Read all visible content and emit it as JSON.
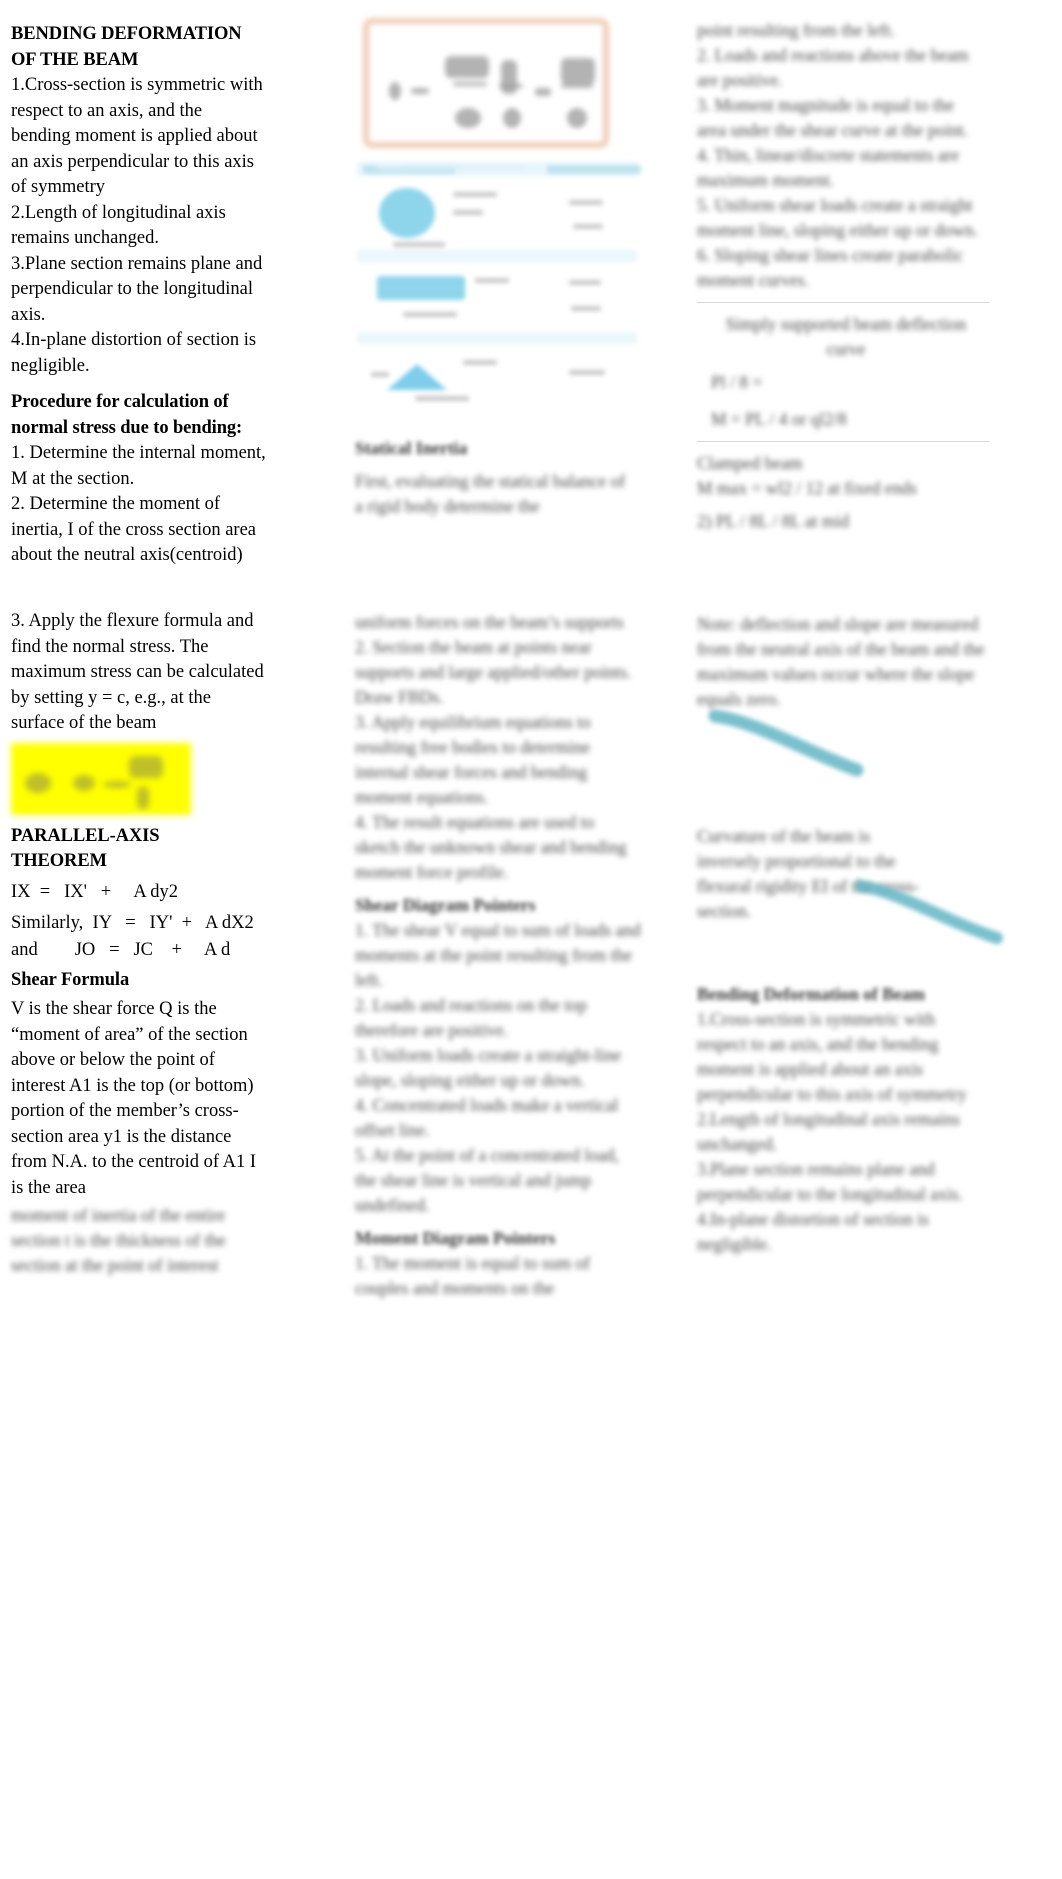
{
  "document": {
    "title": "BENDING DEFORMATION OF THE BEAM",
    "layout": "three-column study notes",
    "highlight_color": "#ffff00",
    "accent_border_color": "#f0cdb6",
    "accent_table_color": "#8ed5ec",
    "accent_curve_color": "#62b5c4"
  },
  "column1": {
    "heading1_line1": "BENDING DEFORMATION",
    "heading1_line2": "OF THE BEAM",
    "item1": "1.Cross-section is symmetric with respect to an axis, and the bending moment is applied about an axis perpendicular to this axis of symmetry",
    "item2": "2.Length of longitudinal axis remains unchanged.",
    "item3": "3.Plane section remains plane and perpendicular to the longitudinal axis.",
    "item4": " 4.In-plane distortion of section is negligible.",
    "heading2_line1": "Procedure for calculation of",
    "heading2_line2": "normal stress due to bending:",
    "step1": "1. Determine the internal moment, M at the section.",
    "step2": "2. Determine the moment of inertia, I of the cross section area about the neutral axis(centroid)"
  },
  "column1_lower": {
    "step3": "3. Apply the flexure formula and find the normal stress.   The maximum stress can be calculated by setting y = c, e.g., at the surface of the beam",
    "highlighted_formula": "(blurred highlighted flexure formula)",
    "heading_parallel_axis_line1": "PARALLEL-AXIS",
    "heading_parallel_axis_line2": "THEOREM",
    "formula_ix": "IX  =   IX'   +     A dy2",
    "formula_iy": "Similarly,  IY   =   IY'  +   A dX2",
    "formula_jo": "and        JO   =   JC    +     A d",
    "heading_shear_formula": "Shear Formula",
    "shear_body": "V is the shear force Q is the “moment of area” of the section above or below      the point of interest A1 is the top (or bottom) portion of the member’s cross-section area y1 is the distance from N.A. to the centroid of A1 I is the area",
    "shear_body_blurred_line1": "moment of inertia of the entire",
    "shear_body_blurred_line2": "section t is the thickness of the",
    "shear_body_blurred_line3": "section at the point of interest"
  },
  "column2": {
    "formula_card_caption": "(blurred boxed formula with peach border)",
    "table_caption": "(blurred reference table of cross-section shapes and properties)",
    "heading_statical": "Statical Inertia",
    "blurred_paragraph_1": "First, evaluating the statical balance of a rigid body determine the",
    "block2_lines": [
      "uniform forces on the beam’s supports",
      "2. Section the beam at points near supports and large applied/other points.  Draw FBDs.",
      "3. Apply equilibrium equations to resulting free bodies to determine internal shear forces and bending moment equations.",
      "4. The result equations are used to sketch the unknown shear and bending moment force profile."
    ],
    "heading_shear_diagram": "Shear Diagram Pointers",
    "shear_diagram_lines": [
      "1. The shear V equal to sum of loads and moments at the point resulting from the left.",
      "2. Loads and reactions on the top therefore are positive.",
      "3. Uniform loads create a straight-line slope, sloping either up or down.",
      "4. Concentrated loads make a vertical offset line.",
      "5. At the point of a concentrated load, the shear line is vertical and jump undefined."
    ],
    "heading_moment_diagram": "Moment Diagram Pointers",
    "moment_diagram_lines": [
      "1. The moment is equal to sum of couples and moments on the"
    ]
  },
  "column3": {
    "block1_lines": [
      "point resulting from the left.",
      "2. Loads and reactions above the beam are positive.",
      "3. Moment magnitude is equal to the area under the shear curve at the point.",
      "4. Thin, linear/discrete statements are maximum moment.",
      "5. Uniform shear loads create a straight moment line, sloping either up or down.",
      "6. Sloping shear lines create parabolic moment curves."
    ],
    "note_heading": "Simply supported beam deflection curve",
    "note_lines": [
      "Pl / 8 =",
      "M  =  PL  / 4  or  ql2/8"
    ],
    "note2_heading": "Clamped beam",
    "note2_lines": [
      "M max   =   wl2 / 12 at fixed ends",
      "2) PL / 8L / 8L at mid"
    ],
    "block2_lines": [
      "Note: deflection and slope are measured from the neutral axis of the beam and the maximum values occur where the slope equals zero.",
      "Curvature of the beam is inversely proportional to the flexural rigidity EI of the cross-section."
    ],
    "heading_bending_deformation": "Bending Deformation of Beam",
    "bending_lines": [
      "1.Cross-section is symmetric with respect to an axis, and the bending moment is applied about an axis perpendicular to this axis of symmetry",
      "2.Length of longitudinal axis remains unchanged.",
      "3.Plane section remains plane and perpendicular to the longitudinal axis.",
      "4.In-plane distortion of section is negligible."
    ]
  }
}
